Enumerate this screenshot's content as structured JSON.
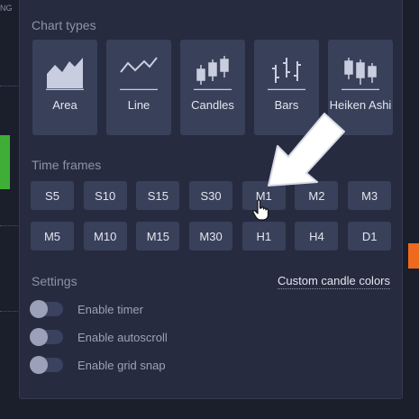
{
  "chart_types": {
    "title": "Chart types",
    "items": [
      {
        "label": "Area",
        "icon": "area-chart-icon"
      },
      {
        "label": "Line",
        "icon": "line-chart-icon"
      },
      {
        "label": "Candles",
        "icon": "candles-chart-icon"
      },
      {
        "label": "Bars",
        "icon": "bars-chart-icon"
      },
      {
        "label": "Heiken Ashi",
        "icon": "heiken-ashi-chart-icon"
      }
    ]
  },
  "time_frames": {
    "title": "Time frames",
    "items": [
      "S5",
      "S10",
      "S15",
      "S30",
      "M1",
      "M2",
      "M3",
      "M5",
      "M10",
      "M15",
      "M30",
      "H1",
      "H4",
      "D1"
    ]
  },
  "settings": {
    "title": "Settings",
    "custom_colors_link": "Custom candle colors",
    "toggles": [
      {
        "label": "Enable timer",
        "on": false
      },
      {
        "label": "Enable autoscroll",
        "on": false
      },
      {
        "label": "Enable grid snap",
        "on": false
      }
    ]
  },
  "background": {
    "edge_text": "NG"
  },
  "colors": {
    "panel": "#262b3f",
    "button": "#39405a",
    "text": "#e3e6ef",
    "muted": "#8c93ab",
    "green": "#3fae37",
    "orange": "#ef6a1e"
  }
}
